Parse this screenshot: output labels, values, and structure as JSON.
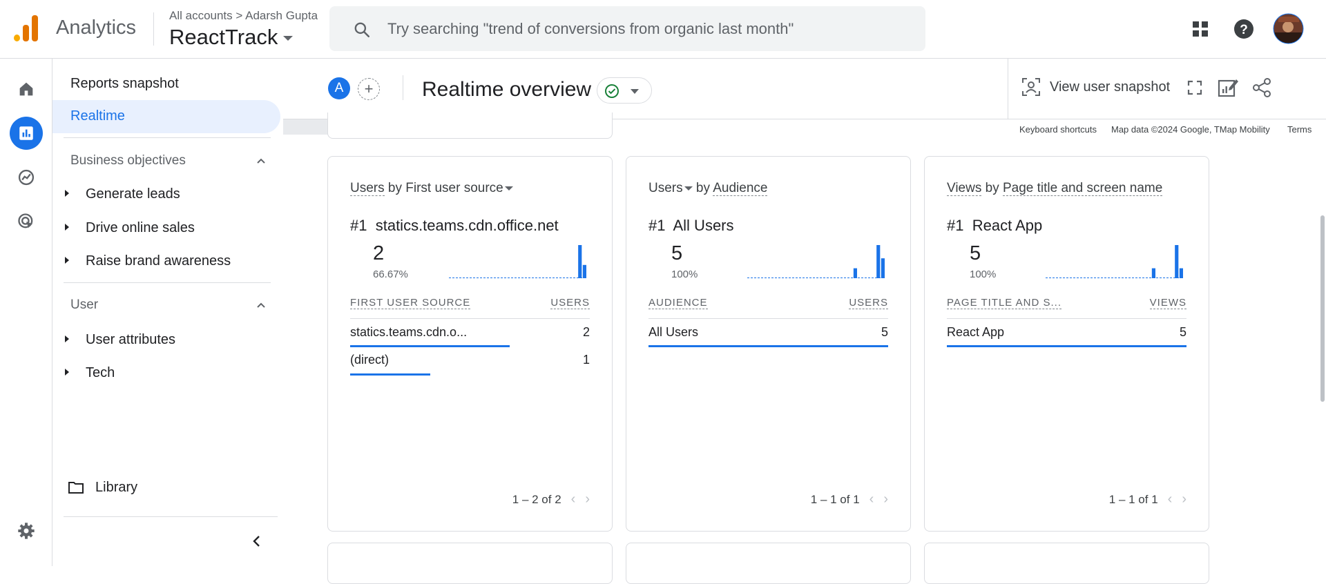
{
  "app": {
    "name": "Analytics",
    "breadcrumb_accounts": "All accounts",
    "breadcrumb_sep": ">",
    "breadcrumb_user": "Adarsh Gupta",
    "property": "ReactTrack"
  },
  "search": {
    "placeholder": "Try searching \"trend of conversions from organic last month\""
  },
  "nav": {
    "reports_snapshot": "Reports snapshot",
    "realtime": "Realtime",
    "business_objectives": "Business objectives",
    "generate_leads": "Generate leads",
    "drive_online_sales": "Drive online sales",
    "raise_brand_awareness": "Raise brand awareness",
    "user": "User",
    "user_attributes": "User attributes",
    "tech": "Tech",
    "library": "Library"
  },
  "header": {
    "comparison_avatar": "A",
    "title": "Realtime overview",
    "view_user_snapshot": "View user snapshot"
  },
  "map": {
    "keyboard_shortcuts": "Keyboard shortcuts",
    "map_data": "Map data ©2024 Google, TMap Mobility",
    "terms": "Terms"
  },
  "colors": {
    "accent": "#1a73e8",
    "status_ok": "#188038"
  },
  "cards": [
    {
      "title_metric": "Users",
      "title_by": "by",
      "title_dimension": "First user source",
      "rank": "#1",
      "top_name": "statics.teams.cdn.office.net",
      "top_value": "2",
      "top_pct": "66.67%",
      "col_dim": "FIRST USER SOURCE",
      "col_metric": "USERS",
      "rows": [
        {
          "label": "statics.teams.cdn.o...",
          "value": "2",
          "share": 0.667
        },
        {
          "label": "(direct)",
          "value": "1",
          "share": 0.333
        }
      ],
      "pager": "1 – 2 of 2",
      "spark": [
        0,
        0,
        0,
        0,
        0,
        0,
        0,
        0,
        0,
        0,
        0,
        0,
        0,
        0,
        0,
        0,
        0,
        0,
        0,
        0,
        0,
        0,
        0,
        0,
        0,
        0,
        0,
        0,
        1,
        0.4
      ]
    },
    {
      "title_metric": "Users",
      "title_by": "by",
      "title_dimension": "Audience",
      "rank": "#1",
      "top_name": "All Users",
      "top_value": "5",
      "top_pct": "100%",
      "col_dim": "AUDIENCE",
      "col_metric": "USERS",
      "rows": [
        {
          "label": "All Users",
          "value": "5",
          "share": 1.0
        }
      ],
      "pager": "1 – 1 of 1",
      "spark": [
        0,
        0,
        0,
        0,
        0,
        0,
        0,
        0,
        0,
        0,
        0,
        0,
        0,
        0,
        0,
        0,
        0,
        0,
        0,
        0,
        0,
        0,
        0,
        0.3,
        0,
        0,
        0,
        0,
        1,
        0.6
      ]
    },
    {
      "title_metric": "Views",
      "title_by": "by",
      "title_dimension": "Page title and screen name",
      "rank": "#1",
      "top_name": "React App",
      "top_value": "5",
      "top_pct": "100%",
      "col_dim": "PAGE TITLE AND S...",
      "col_metric": "VIEWS",
      "rows": [
        {
          "label": "React App",
          "value": "5",
          "share": 1.0
        }
      ],
      "pager": "1 – 1 of 1",
      "spark": [
        0,
        0,
        0,
        0,
        0,
        0,
        0,
        0,
        0,
        0,
        0,
        0,
        0,
        0,
        0,
        0,
        0,
        0,
        0,
        0,
        0,
        0,
        0,
        0.3,
        0,
        0,
        0,
        0,
        1,
        0.3
      ]
    }
  ]
}
